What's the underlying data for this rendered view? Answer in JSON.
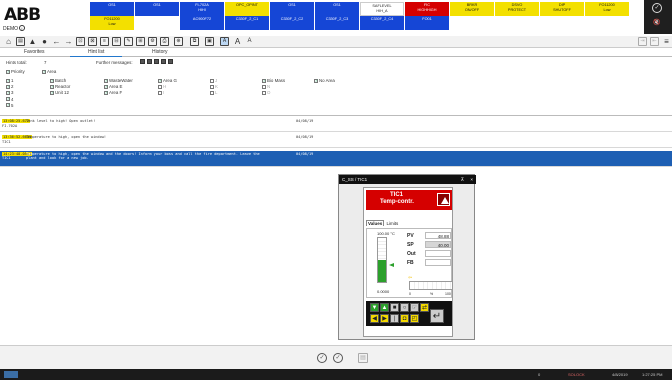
{
  "brand": {
    "logo": "ABB",
    "system": "DEMO",
    "info": "i"
  },
  "alarm_bands": [
    {
      "label": "OS1",
      "sub": "",
      "bg": "#1546d6",
      "cls": ""
    },
    {
      "label": "OS1",
      "sub": "",
      "bg": "#1546d6",
      "cls": ""
    },
    {
      "label": "FI-702A",
      "sub": "HIHI",
      "bg": "#1546d6",
      "cls": ""
    },
    {
      "label": "OPC_OPINT",
      "sub": "",
      "bg": "#f3e000",
      "cls": "yel"
    },
    {
      "label": "OS1",
      "sub": "",
      "bg": "#1546d6",
      "cls": ""
    },
    {
      "label": "OS1",
      "sub": "",
      "bg": "#1546d6",
      "cls": ""
    },
    {
      "label": "SAFLEVEL",
      "sub": "HIH_A",
      "bg": "#ffffff",
      "cls": "white"
    },
    {
      "label": "FIC",
      "sub": "HIGHHIGH",
      "bg": "#d50000",
      "cls": ""
    },
    {
      "label": "BRKR",
      "sub": "ON/OFF",
      "bg": "#f3e000",
      "cls": "yel"
    },
    {
      "label": "DSVO",
      "sub": "PROTECT",
      "bg": "#f3e000",
      "cls": "yel"
    },
    {
      "label": "DIP",
      "sub": "SHUTOFF",
      "bg": "#f3e000",
      "cls": "yel"
    },
    {
      "label": "FIC",
      "sub": "HIGH",
      "bg": "#f3e000",
      "cls": "yel"
    },
    {
      "label": "FO11200",
      "sub": "Low",
      "bg": "#f3e000",
      "cls": "yel"
    },
    {
      "label": "FO11200",
      "sub": "Low",
      "bg": "#f3e000",
      "cls": "yel"
    },
    {
      "label": "AC900F72",
      "sub": "",
      "bg": "#1546d6",
      "cls": ""
    },
    {
      "label": "C330F_2_C1",
      "sub": "",
      "bg": "#1546d6",
      "cls": ""
    },
    {
      "label": "C330F_2_C2",
      "sub": "",
      "bg": "#1546d6",
      "cls": ""
    },
    {
      "label": "C330F_2_C3",
      "sub": "",
      "bg": "#1546d6",
      "cls": ""
    },
    {
      "label": "C330F_2_C4",
      "sub": "",
      "bg": "#1546d6",
      "cls": ""
    },
    {
      "label": "FO01",
      "sub": "",
      "bg": "#1546d6",
      "cls": ""
    }
  ],
  "top_right": {
    "chevrons": "»",
    "count": "28",
    "icon1": "check-circle-icon",
    "icon2": "audio-icon"
  },
  "tabs": {
    "favorites": "Favorites",
    "hintlist": "Hint list",
    "history": "History"
  },
  "filter": {
    "hints_total_label": "Hints total:",
    "hints_total_value": "7",
    "further_messages_label": "Further messages:",
    "priority": "Priority",
    "area": "Area",
    "priorities": [
      "1",
      "2",
      "3",
      "4",
      "5"
    ],
    "col2": [
      "Batch",
      "Reactor",
      "Unit 12"
    ],
    "col3": [
      "WasteWater",
      "Area E",
      "Area F"
    ],
    "col4": [
      "Area G",
      "H",
      "I"
    ],
    "col5": [
      "J",
      "K",
      "L"
    ],
    "col6": [
      "Bio Mass",
      "N",
      "O"
    ],
    "no_area": "No Area"
  },
  "rows": [
    {
      "time": "13:08:25.677",
      "msg": "Tank level to high! Open outlet!",
      "date": "04/08/19",
      "obj": "FI-702A"
    },
    {
      "time": "13:36:52.6631",
      "msg": "Temperature to high, open the window!",
      "date": "04/08/19",
      "obj": "TIC1"
    },
    {
      "time": "14:23:48.0551",
      "msg": "Temperature to high, open the window and the doors! Inform your boss and call the fire department. Leave the plant and look for a new job.",
      "date": "04/08/19",
      "obj": "TIC1"
    }
  ],
  "faceplate": {
    "title": "C_SS / TIC1",
    "tag": "TIC1",
    "desc": "Temp-contr.",
    "tab_values": "Values",
    "tab_limits": "Limits",
    "scale_max": "100.00 °C",
    "scale_min": "0.0000",
    "pv_label": "PV",
    "pv_value": "48.88",
    "sp_label": "SP",
    "sp_value": "40.00",
    "out_label": "Out",
    "fb_label": "FB",
    "pv_fill": 0.49,
    "out_scale": [
      "0",
      "%",
      "100"
    ],
    "pin": "⊼",
    "close": "×"
  },
  "status": {
    "item1": "0",
    "item2": "SOLOCK",
    "date": "4/8/2019",
    "time": "1:27:25 PM"
  }
}
